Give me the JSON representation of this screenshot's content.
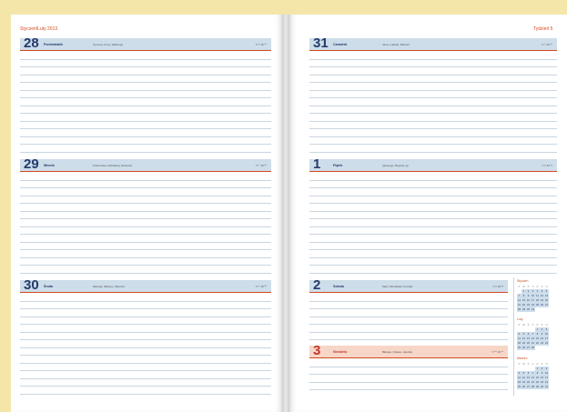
{
  "header": {
    "month_left": "Styczeń/Luty 2013",
    "week_right": "Tydzień 5"
  },
  "days": [
    {
      "num": "28",
      "name": "Poniedziałek",
      "names": "Tymona, Ireny, Walerego",
      "sun": "7:¹⁸ 15:⁵⁴",
      "weekend": false
    },
    {
      "num": "29",
      "name": "Wtorek",
      "names": "Franciszka, Zdzisława, Dariusza",
      "sun": "7:¹⁷ 15:⁵⁶",
      "weekend": false
    },
    {
      "num": "30",
      "name": "Środa",
      "names": "Macieja, Martyny, Marcina",
      "sun": "7:¹⁵ 15:⁵⁸",
      "weekend": false
    },
    {
      "num": "31",
      "name": "Czwartek",
      "names": "Jana, Ludwiki, Marceli",
      "sun": "7:¹⁴ 16:⁰⁰",
      "weekend": false
    },
    {
      "num": "1",
      "name": "Piątek",
      "names": "Ignacego, Brygidy, Igi",
      "sun": "7:¹² 16:⁰²",
      "weekend": false
    },
    {
      "num": "2",
      "name": "Sobota",
      "names": "Marii, Mirosława, Kornelii",
      "sun": "7:¹¹ 16:⁰³",
      "weekend": false
    },
    {
      "num": "3",
      "name": "Niedziela",
      "names": "Błażeja, Oskara, Hipolita",
      "sun": "7:⁰⁹ 16:⁰⁵",
      "weekend": true
    }
  ],
  "mini_calendars": [
    {
      "title": "Styczeń",
      "weekdays": [
        "P",
        "W",
        "Ś",
        "C",
        "P",
        "S",
        "N"
      ],
      "cells": [
        "",
        "1",
        "2",
        "3",
        "4",
        "5",
        "6",
        "7",
        "8",
        "9",
        "10",
        "11",
        "12",
        "13",
        "14",
        "15",
        "16",
        "17",
        "18",
        "19",
        "20",
        "21",
        "22",
        "23",
        "24",
        "25",
        "26",
        "27",
        "28",
        "29",
        "30",
        "31",
        "",
        "",
        ""
      ]
    },
    {
      "title": "Luty",
      "weekdays": [
        "P",
        "W",
        "Ś",
        "C",
        "P",
        "S",
        "N"
      ],
      "cells": [
        "",
        "",
        "",
        "",
        "1",
        "2",
        "3",
        "4",
        "5",
        "6",
        "7",
        "8",
        "9",
        "10",
        "11",
        "12",
        "13",
        "14",
        "15",
        "16",
        "17",
        "18",
        "19",
        "20",
        "21",
        "22",
        "23",
        "24",
        "25",
        "26",
        "27",
        "28",
        "",
        "",
        ""
      ]
    },
    {
      "title": "Marzec",
      "weekdays": [
        "P",
        "W",
        "Ś",
        "C",
        "P",
        "S",
        "N"
      ],
      "cells": [
        "",
        "",
        "",
        "",
        "1",
        "2",
        "3",
        "4",
        "5",
        "6",
        "7",
        "8",
        "9",
        "10",
        "11",
        "12",
        "13",
        "14",
        "15",
        "16",
        "17",
        "18",
        "19",
        "20",
        "21",
        "22",
        "23",
        "24",
        "25",
        "26",
        "27",
        "28",
        "29",
        "30",
        "31"
      ]
    }
  ]
}
